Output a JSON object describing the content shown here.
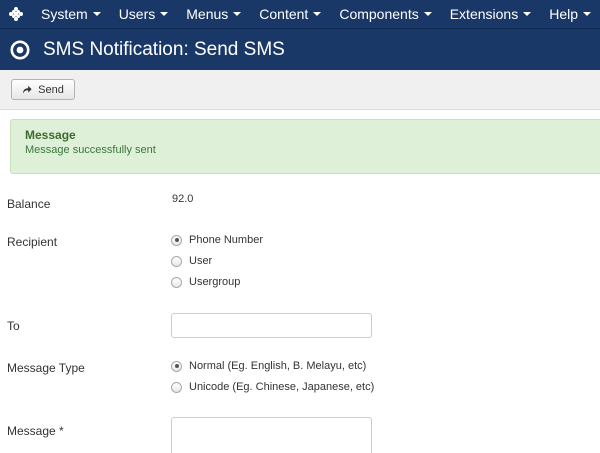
{
  "navbar": {
    "menu": [
      {
        "label": "System"
      },
      {
        "label": "Users"
      },
      {
        "label": "Menus"
      },
      {
        "label": "Content"
      },
      {
        "label": "Components"
      },
      {
        "label": "Extensions"
      },
      {
        "label": "Help"
      }
    ]
  },
  "header": {
    "title": "SMS Notification: Send SMS"
  },
  "toolbar": {
    "send_label": "Send"
  },
  "alert": {
    "heading": "Message",
    "text": "Message successfully sent"
  },
  "form": {
    "balance": {
      "label": "Balance",
      "value": "92.0"
    },
    "recipient": {
      "label": "Recipient",
      "options": [
        {
          "label": "Phone Number",
          "checked": true
        },
        {
          "label": "User",
          "checked": false
        },
        {
          "label": "Usergroup",
          "checked": false
        }
      ]
    },
    "to": {
      "label": "To",
      "value": ""
    },
    "message_type": {
      "label": "Message Type",
      "options": [
        {
          "label": "Normal (Eg. English, B. Melayu, etc)",
          "checked": true
        },
        {
          "label": "Unicode (Eg. Chinese, Japanese, etc)",
          "checked": false
        }
      ]
    },
    "message": {
      "label": "Message *",
      "value": ""
    }
  },
  "colors": {
    "navbar_bg": "#1a3867",
    "alert_bg": "#dff0d8",
    "alert_text": "#3c763d"
  }
}
